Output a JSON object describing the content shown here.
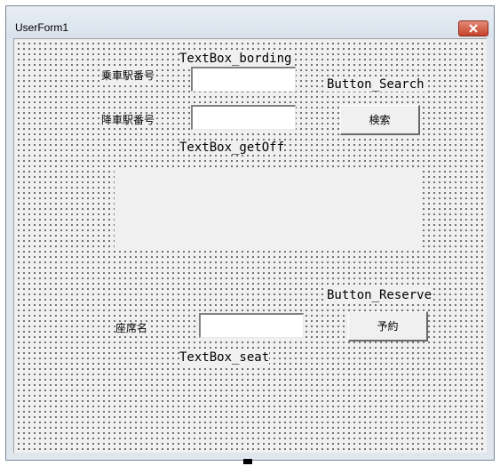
{
  "window": {
    "title": "UserForm1",
    "close_icon": "close-icon"
  },
  "form": {
    "boarding_label": "乗車駅番号",
    "getoff_label": "降車駅番号",
    "seat_label": "座席名",
    "textbox_bording_name": "TextBox_bording",
    "textbox_getoff_name": "TextBox_getOff",
    "textbox_seat_name": "TextBox_seat",
    "button_search_name": "Button_Search",
    "button_reserve_name": "Button_Reserve",
    "search_button_label": "検索",
    "reserve_button_label": "予約",
    "boarding_value": "",
    "getoff_value": "",
    "seat_value": ""
  },
  "colors": {
    "titlebar": "#dfe6ee",
    "client": "#f0f0f0",
    "close_button": "#c7432b"
  }
}
